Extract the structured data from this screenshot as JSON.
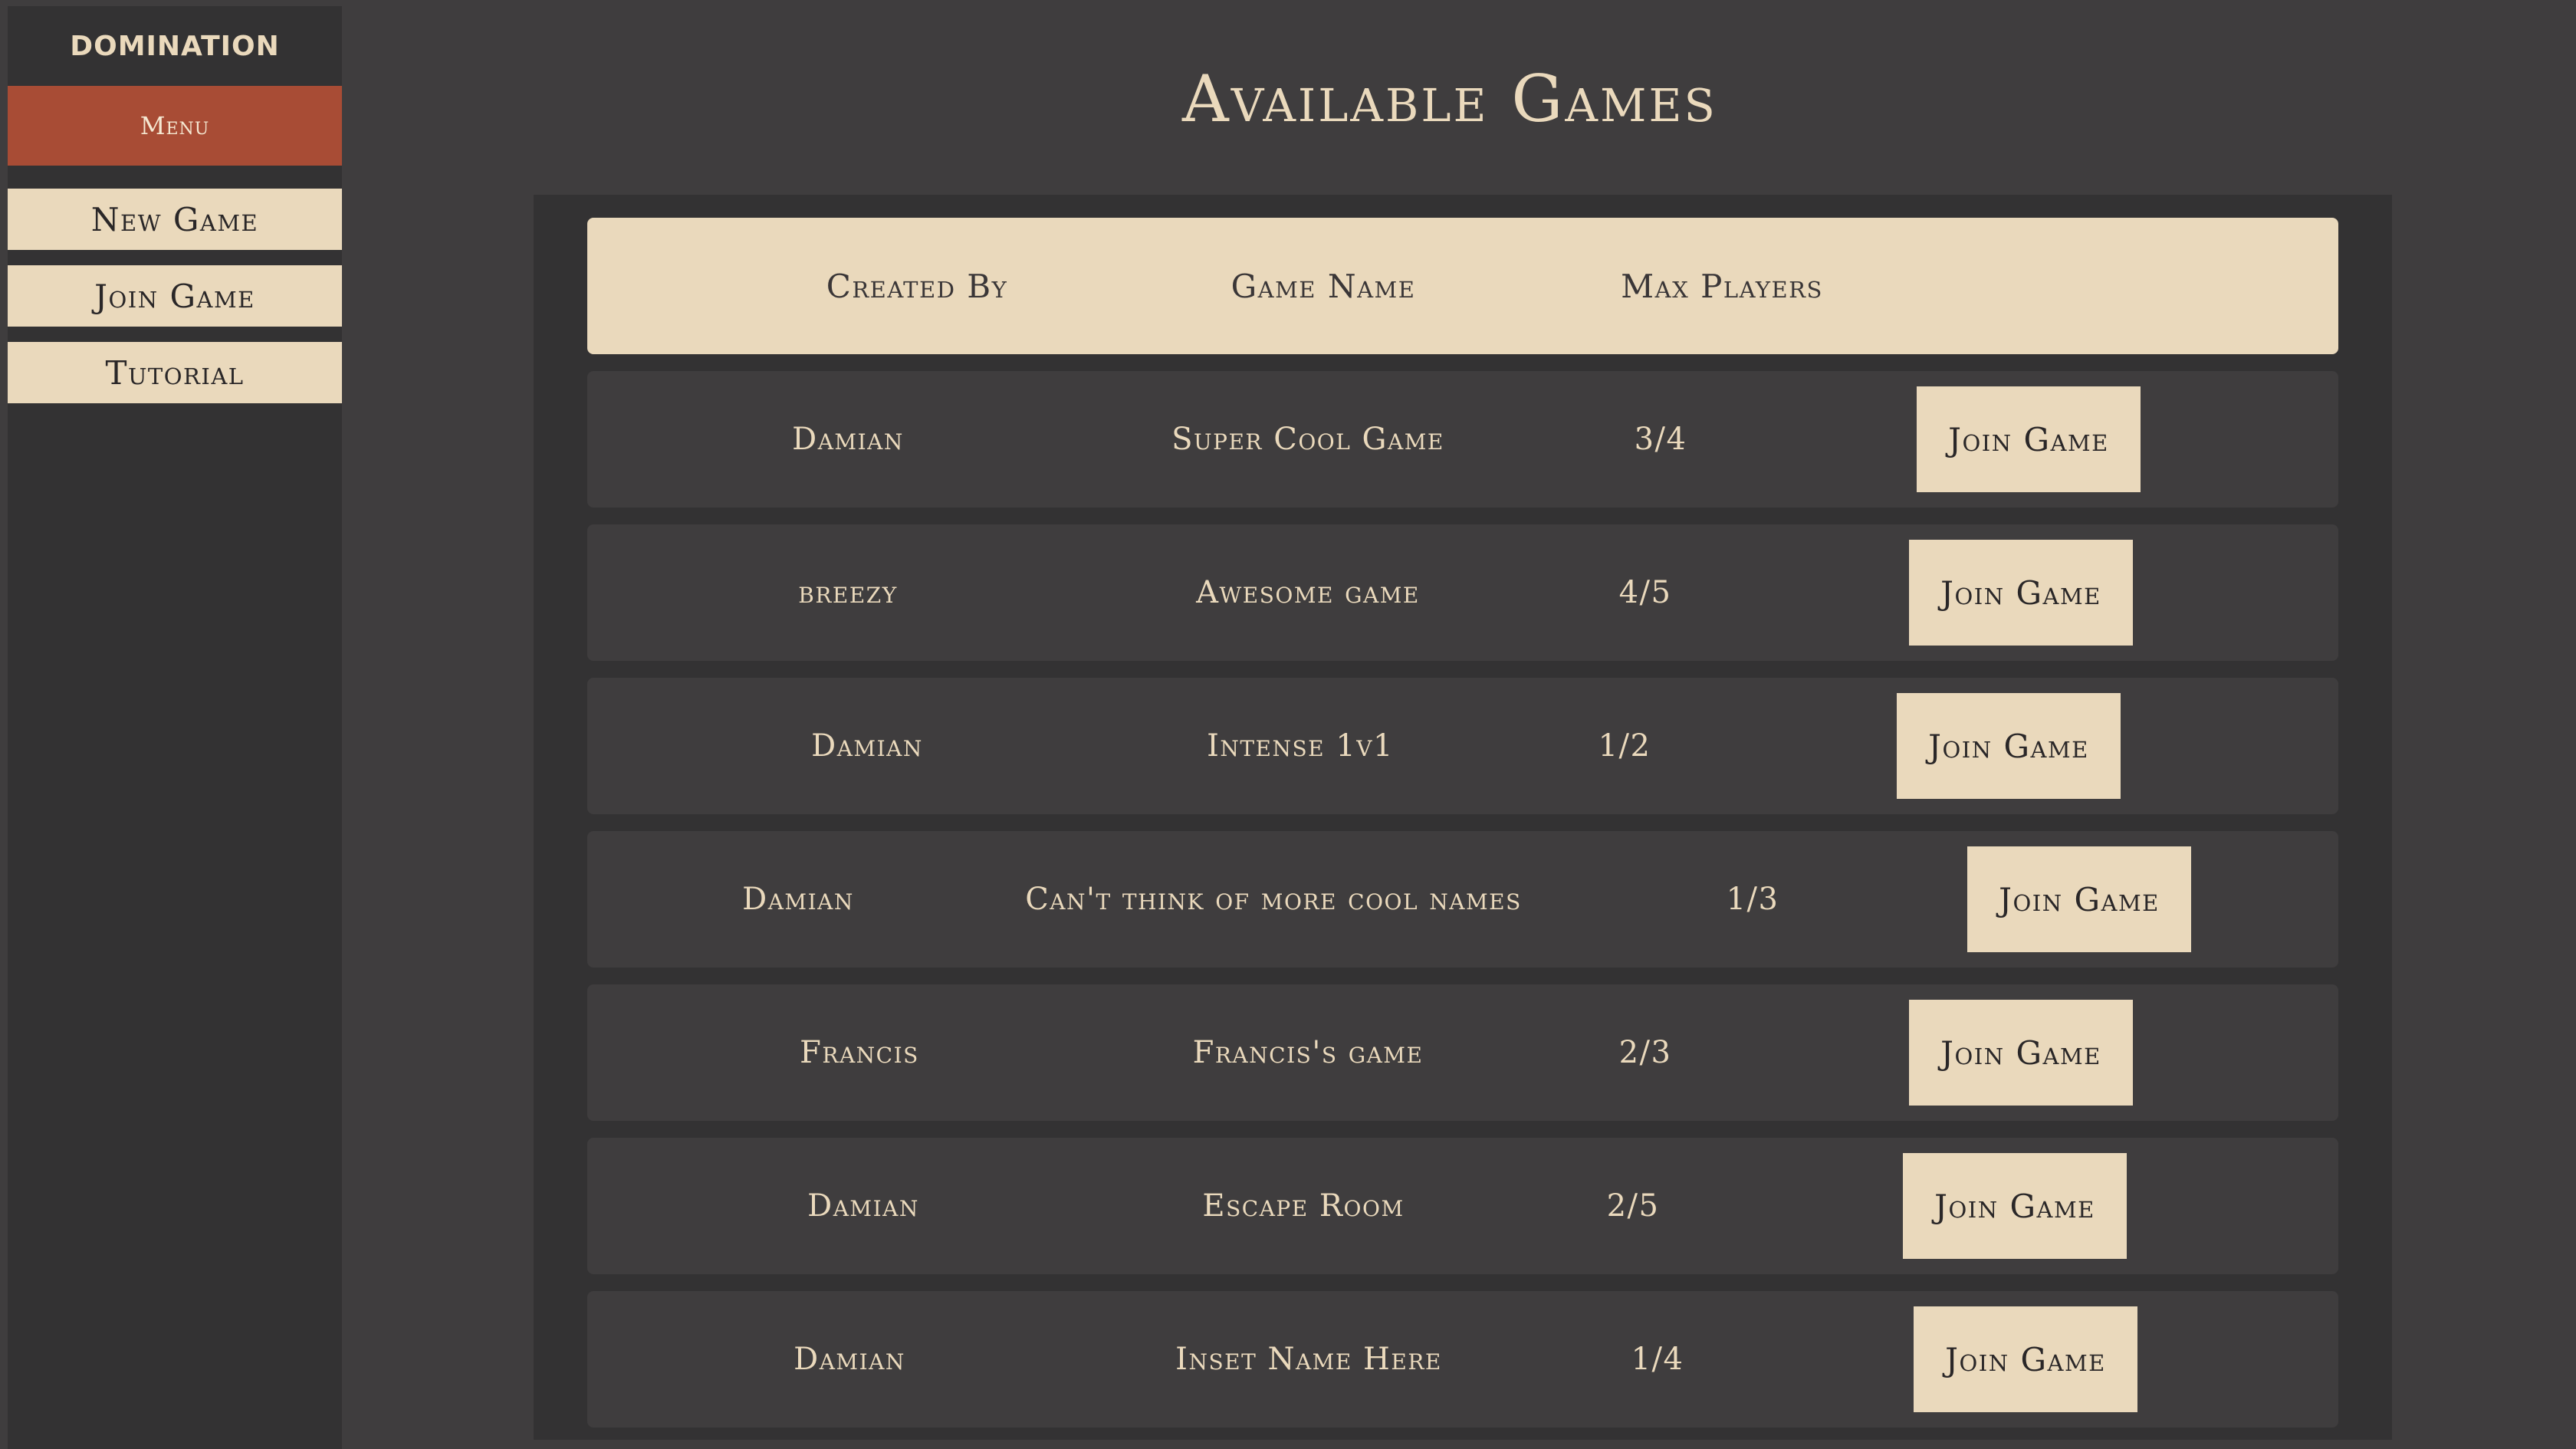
{
  "sidebar": {
    "brand": "DOMINATION",
    "menu_label": "Menu",
    "items": [
      {
        "label": "New Game"
      },
      {
        "label": "Join Game"
      },
      {
        "label": "Tutorial"
      }
    ]
  },
  "page": {
    "title": "Available Games"
  },
  "table": {
    "columns": [
      "Created By",
      "Game Name",
      "Max Players"
    ],
    "rows": [
      {
        "creator": "Damian",
        "name": "Super Cool Game",
        "players": "3/4",
        "action": "Join Game"
      },
      {
        "creator": "breezy",
        "name": "Awesome game",
        "players": "4/5",
        "action": "Join Game"
      },
      {
        "creator": "Damian",
        "name": "Intense 1v1",
        "players": "1/2",
        "action": "Join Game"
      },
      {
        "creator": "Damian",
        "name": "Can't think of more cool names",
        "players": "1/3",
        "action": "Join Game"
      },
      {
        "creator": "Francis",
        "name": "Francis's game",
        "players": "2/3",
        "action": "Join Game"
      },
      {
        "creator": "Damian",
        "name": "Escape Room",
        "players": "2/5",
        "action": "Join Game"
      },
      {
        "creator": "Damian",
        "name": "Inset Name Here",
        "players": "1/4",
        "action": "Join Game"
      }
    ]
  },
  "colors": {
    "background": "#3f3d3e",
    "sidebar": "#333233",
    "accent": "#a84c35",
    "cream": "#ead9bc"
  }
}
